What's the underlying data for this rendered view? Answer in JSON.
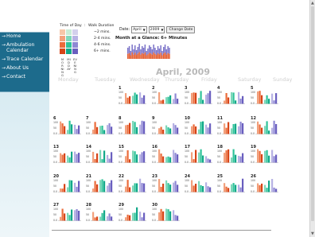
{
  "nav": {
    "items": [
      {
        "label": "Home"
      },
      {
        "label": "Ambulation Calendar"
      },
      {
        "label": "Trace Calendar"
      },
      {
        "label": "About Us"
      },
      {
        "label": "Contact"
      }
    ],
    "arrow_glyph": "→",
    "bg_color": "#1d6b8c"
  },
  "legend": {
    "time_of_day_label": "Time of Day",
    "separator": ":",
    "walk_duration_label": "Walk Duration",
    "duration_labels": [
      "~2 mins.",
      "2-4 mins.",
      "4-6 mins.",
      "6+ mins."
    ],
    "time_of_day_columns": [
      "MORNING",
      "MIDDAY",
      "EVENING"
    ],
    "colors": [
      [
        "#f6c6a8",
        "#c7ecd6",
        "#d3d0ec"
      ],
      [
        "#f2a07c",
        "#7fd8b9",
        "#b7b2e4"
      ],
      [
        "#eb6b3a",
        "#2fc39a",
        "#8f88d4"
      ],
      [
        "#d74518",
        "#13a98a",
        "#6a5fbf"
      ]
    ]
  },
  "date_controls": {
    "label": "Date:",
    "month_value": "April",
    "year_value": "2009",
    "button_label": "Change Date"
  },
  "glance": {
    "title": "Month at a Glance: 6+ Minutes",
    "values": [
      0.7,
      0.8,
      0.5,
      0.9,
      0.6,
      0.85,
      0.55,
      0.75,
      0.95,
      0.6,
      0.8,
      0.7,
      0.9,
      0.5,
      0.65,
      0.85,
      0.75,
      0.6,
      0.9,
      0.7,
      0.55,
      0.8,
      0.65,
      0.85,
      0.5,
      0.75,
      0.9,
      0.6,
      0.8,
      0.7
    ],
    "color_top": "#7a72c8",
    "color_bottom": "#e35a2c"
  },
  "calendar": {
    "title": "April, 2009",
    "weekdays": [
      "Monday",
      "Tuesday",
      "Wednesday",
      "Thursday",
      "Friday",
      "Saturday",
      "Sunday"
    ],
    "y_ticks": [
      "100",
      "50",
      "0.0"
    ],
    "start_offset": 2,
    "days_in_month": 30
  }
}
